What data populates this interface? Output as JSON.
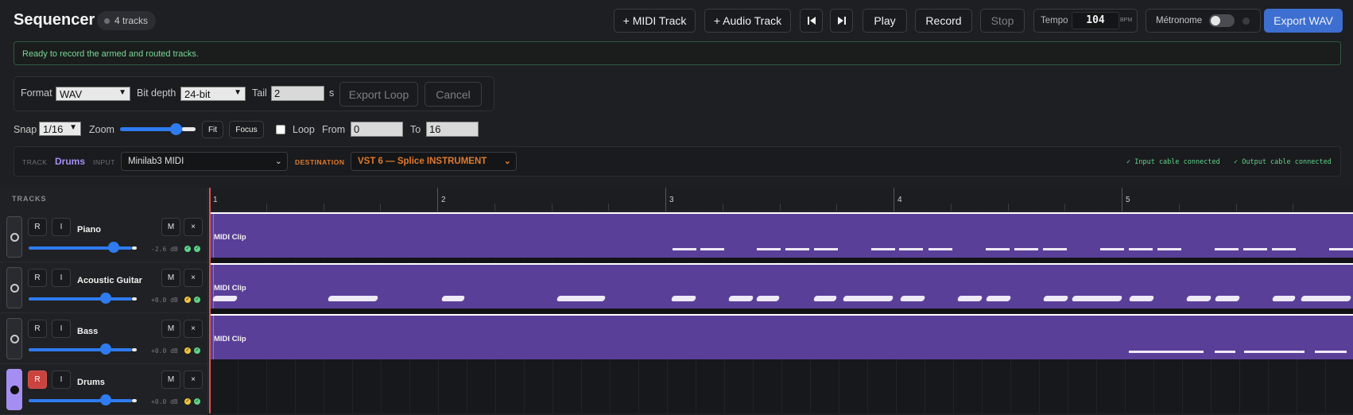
{
  "app": {
    "title": "Sequencer",
    "track_count": "4 tracks"
  },
  "toolbar": {
    "add_midi": "+ MIDI Track",
    "add_audio": "+ Audio Track",
    "play": "Play",
    "record": "Record",
    "stop": "Stop",
    "tempo_label": "Tempo",
    "tempo_value": "104",
    "tempo_unit": "BPM",
    "metronome_label": "Métronome",
    "export": "Export WAV"
  },
  "status": "Ready to record the armed and routed tracks.",
  "export_panel": {
    "format_label": "Format",
    "format_value": "WAV",
    "bitdepth_label": "Bit depth",
    "bitdepth_value": "24-bit",
    "tail_label": "Tail",
    "tail_value": "2",
    "tail_unit": "s",
    "export_loop": "Export Loop",
    "cancel": "Cancel"
  },
  "transport": {
    "snap_label": "Snap",
    "snap_value": "1/16",
    "zoom_label": "Zoom",
    "fit": "Fit",
    "focus": "Focus",
    "loop_label": "Loop",
    "from_label": "From",
    "from_value": "0",
    "to_label": "To",
    "to_value": "16"
  },
  "routing": {
    "track_label": "TRACK",
    "track_name": "Drums",
    "input_label": "INPUT",
    "input_value": "Minilab3 MIDI",
    "destination_label": "DESTINATION",
    "destination_value": "VST 6 — Splice INSTRUMENT",
    "input_cable": "✓ Input cable connected",
    "output_cable": "✓ Output cable connected"
  },
  "tracks_header": "TRACKS",
  "ruler": [
    "1",
    "2",
    "3",
    "4",
    "5"
  ],
  "tracks": [
    {
      "name": "Piano",
      "db": "-2.6 dB",
      "r": "R",
      "i": "I",
      "m": "M",
      "x": "×",
      "clip": "MIDI Clip",
      "armed": false,
      "volume": 0.83
    },
    {
      "name": "Acoustic Guitar",
      "db": "+0.0 dB",
      "r": "R",
      "i": "I",
      "m": "M",
      "x": "×",
      "clip": "MIDI Clip",
      "armed": false,
      "volume": 0.75
    },
    {
      "name": "Bass",
      "db": "+0.0 dB",
      "r": "R",
      "i": "I",
      "m": "M",
      "x": "×",
      "clip": "MIDI Clip",
      "armed": false,
      "volume": 0.75
    },
    {
      "name": "Drums",
      "db": "+0.0 dB",
      "r": "R",
      "i": "I",
      "m": "M",
      "x": "×",
      "clip": "",
      "armed": true,
      "volume": 0.75
    }
  ],
  "colors": {
    "accent": "#3d6fd1",
    "clip": "#5a3f99",
    "armed": "#a58ef2",
    "record": "#c9433f"
  }
}
